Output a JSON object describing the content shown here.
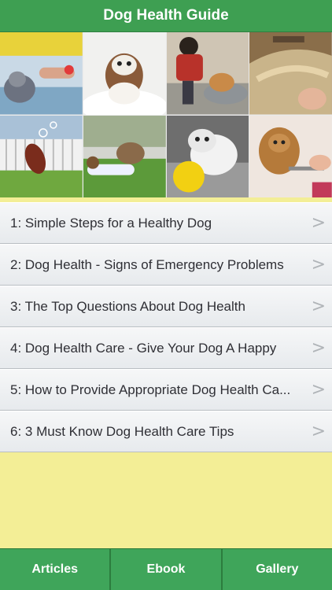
{
  "header": {
    "title": "Dog Health Guide"
  },
  "gallery": {
    "photos": [
      {
        "name": "dog-bath-photo"
      },
      {
        "name": "shih-tzu-bath-photo"
      },
      {
        "name": "man-washing-dog-photo"
      },
      {
        "name": "dog-grooming-photo"
      },
      {
        "name": "dog-jumping-bubbles-photo"
      },
      {
        "name": "woman-dog-lawn-photo"
      },
      {
        "name": "bulldog-ball-photo"
      },
      {
        "name": "yorkie-brushing-photo"
      }
    ]
  },
  "articles": [
    {
      "label": "1: Simple Steps for a Healthy Dog"
    },
    {
      "label": "2: Dog Health - Signs of Emergency Problems"
    },
    {
      "label": "3: The Top Questions About Dog Health"
    },
    {
      "label": "4: Dog Health Care - Give Your Dog A Happy"
    },
    {
      "label": "5: How to Provide Appropriate Dog Health Ca..."
    },
    {
      "label": "6: 3 Must Know Dog Health Care Tips"
    }
  ],
  "chevron": ">",
  "tabs": [
    {
      "label": "Articles"
    },
    {
      "label": "Ebook"
    },
    {
      "label": "Gallery"
    }
  ],
  "colors": {
    "header_green": "#3e9f52",
    "background_yellow": "#f3ee96",
    "tab_green": "#3fa55a"
  }
}
